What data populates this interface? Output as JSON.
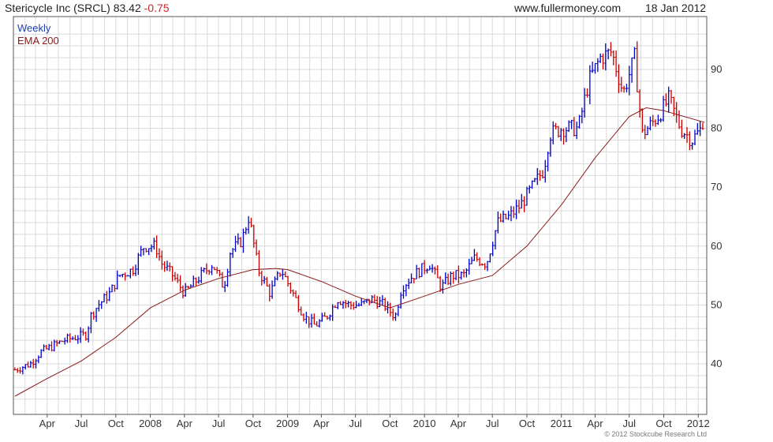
{
  "header": {
    "title": "Stericycle Inc (SRCL)",
    "price": "83.42",
    "change": "-0.75",
    "site": "www.fullermoney.com",
    "date": "18 Jan 2012"
  },
  "legend": {
    "series1": "Weekly",
    "series2": "EMA 200"
  },
  "copyright": "© 2012 Stockcube Research Ltd",
  "colors": {
    "up": "#0000cc",
    "down": "#cc0000",
    "ema": "#8b1a1a",
    "grid": "#d9d9d9",
    "legend_weekly": "#1f3fb0",
    "legend_ema": "#8b1a1a"
  },
  "chart_data": {
    "type": "line",
    "style": "weekly price bars colored by direction (blue up, red down) with EMA 200 overlay",
    "ylim": [
      32,
      98
    ],
    "yticks": [
      40,
      50,
      60,
      70,
      80,
      90
    ],
    "xtick_labels": [
      "Apr",
      "Jul",
      "Oct",
      "2008",
      "Apr",
      "Jul",
      "Oct",
      "2009",
      "Apr",
      "Jul",
      "Oct",
      "2010",
      "Apr",
      "Jul",
      "Oct",
      "2011",
      "Apr",
      "Jul",
      "Oct",
      "2012"
    ],
    "x_range": [
      "2007-01-01",
      "2012-01-20"
    ],
    "grid": true,
    "legend_position": "top-left",
    "series": [
      {
        "name": "Weekly",
        "points": [
          [
            "2007-01-05",
            39
          ],
          [
            "2007-02-15",
            40
          ],
          [
            "2007-03-15",
            42
          ],
          [
            "2007-04-15",
            43
          ],
          [
            "2007-05-15",
            44
          ],
          [
            "2007-06-15",
            44.5
          ],
          [
            "2007-07-15",
            45
          ],
          [
            "2007-07-25",
            48
          ],
          [
            "2007-08-15",
            50
          ],
          [
            "2007-09-15",
            52
          ],
          [
            "2007-10-10",
            55
          ],
          [
            "2007-11-15",
            56
          ],
          [
            "2007-12-15",
            60
          ],
          [
            "2008-01-15",
            60
          ],
          [
            "2008-02-01",
            57
          ],
          [
            "2008-03-01",
            55
          ],
          [
            "2008-04-01",
            52
          ],
          [
            "2008-05-15",
            55
          ],
          [
            "2008-06-15",
            57
          ],
          [
            "2008-07-15",
            53
          ],
          [
            "2008-08-01",
            59
          ],
          [
            "2008-09-01",
            61
          ],
          [
            "2008-09-20",
            65
          ],
          [
            "2008-10-15",
            56
          ],
          [
            "2008-11-15",
            52
          ],
          [
            "2008-12-15",
            56
          ],
          [
            "2009-01-15",
            52
          ],
          [
            "2009-02-15",
            48
          ],
          [
            "2009-03-15",
            46.5
          ],
          [
            "2009-04-15",
            48
          ],
          [
            "2009-05-15",
            51
          ],
          [
            "2009-06-15",
            50
          ],
          [
            "2009-07-15",
            50
          ],
          [
            "2009-08-15",
            51
          ],
          [
            "2009-09-15",
            50
          ],
          [
            "2009-10-15",
            48
          ],
          [
            "2009-11-01",
            53
          ],
          [
            "2009-12-01",
            55
          ],
          [
            "2010-01-15",
            57
          ],
          [
            "2010-02-15",
            53
          ],
          [
            "2010-03-15",
            55
          ],
          [
            "2010-04-15",
            55
          ],
          [
            "2010-05-15",
            58
          ],
          [
            "2010-06-15",
            57
          ],
          [
            "2010-07-15",
            64
          ],
          [
            "2010-08-15",
            65
          ],
          [
            "2010-09-15",
            67
          ],
          [
            "2010-10-15",
            70
          ],
          [
            "2010-11-15",
            73
          ],
          [
            "2010-12-01",
            79
          ],
          [
            "2011-01-01",
            80
          ],
          [
            "2011-02-15",
            80
          ],
          [
            "2011-03-15",
            88
          ],
          [
            "2011-04-15",
            92
          ],
          [
            "2011-05-15",
            93
          ],
          [
            "2011-06-15",
            86
          ],
          [
            "2011-07-15",
            92
          ],
          [
            "2011-08-05",
            79
          ],
          [
            "2011-09-15",
            82
          ],
          [
            "2011-10-15",
            85
          ],
          [
            "2011-11-15",
            80
          ],
          [
            "2011-12-15",
            78
          ],
          [
            "2012-01-10",
            80
          ],
          [
            "2012-01-18",
            83.42
          ]
        ]
      },
      {
        "name": "EMA 200",
        "points": [
          [
            "2007-01-05",
            34.5
          ],
          [
            "2007-04-01",
            37.5
          ],
          [
            "2007-07-01",
            40.5
          ],
          [
            "2007-10-01",
            44.5
          ],
          [
            "2008-01-01",
            49.5
          ],
          [
            "2008-04-01",
            52.5
          ],
          [
            "2008-07-01",
            54.5
          ],
          [
            "2008-10-01",
            56
          ],
          [
            "2008-12-01",
            56.2
          ],
          [
            "2009-01-01",
            56
          ],
          [
            "2009-04-01",
            54
          ],
          [
            "2009-07-01",
            51.5
          ],
          [
            "2009-10-01",
            49.5
          ],
          [
            "2010-01-01",
            51.5
          ],
          [
            "2010-04-01",
            53.5
          ],
          [
            "2010-07-01",
            55
          ],
          [
            "2010-10-01",
            60
          ],
          [
            "2011-01-01",
            67
          ],
          [
            "2011-04-01",
            75
          ],
          [
            "2011-07-01",
            82
          ],
          [
            "2011-08-15",
            83.5
          ],
          [
            "2011-10-01",
            83
          ],
          [
            "2012-01-18",
            81
          ]
        ]
      }
    ]
  }
}
